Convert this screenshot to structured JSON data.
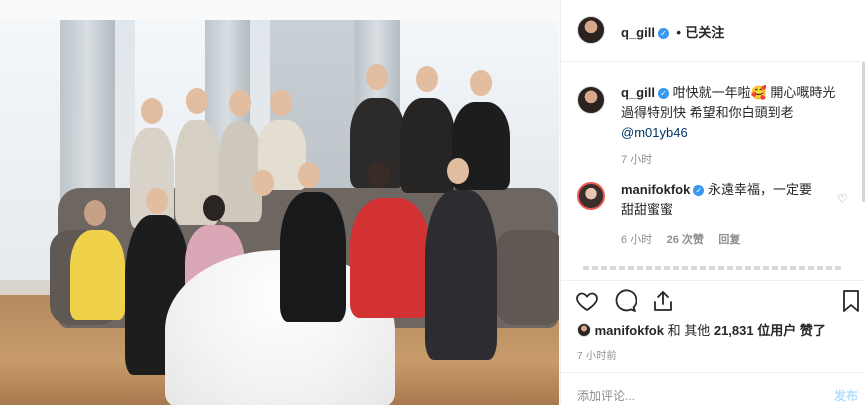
{
  "header": {
    "username": "q_gill",
    "separator": "•",
    "follow_label": "已关注"
  },
  "caption": {
    "username": "q_gill",
    "text_1": "咁快就一年啦🥰 開心嘅時光",
    "text_2": "過得特別快 希望和你白頭到老",
    "mention": "@m01yb46",
    "time": "7 小时"
  },
  "comments": [
    {
      "username": "manifokfok",
      "text_1": "永遠幸福，一定要",
      "text_2": "甜甜蜜蜜",
      "time": "6 小时",
      "likes": "26 次赞",
      "reply": "回复"
    }
  ],
  "likes": {
    "username": "manifokfok",
    "text_mid": "和 其他",
    "count": "21,831",
    "text_end": "位用户 赞了"
  },
  "post_time": "7 小时前",
  "add_comment": {
    "placeholder": "添加评论...",
    "post_label": "发布"
  },
  "icons": {
    "zoom": "zoom-in-icon",
    "heart": "heart-icon",
    "comment": "comment-icon",
    "share": "share-icon",
    "bookmark": "bookmark-icon"
  },
  "colors": {
    "verified": "#3897f0",
    "mention": "#003569",
    "post_disabled": "#b2dffc"
  }
}
